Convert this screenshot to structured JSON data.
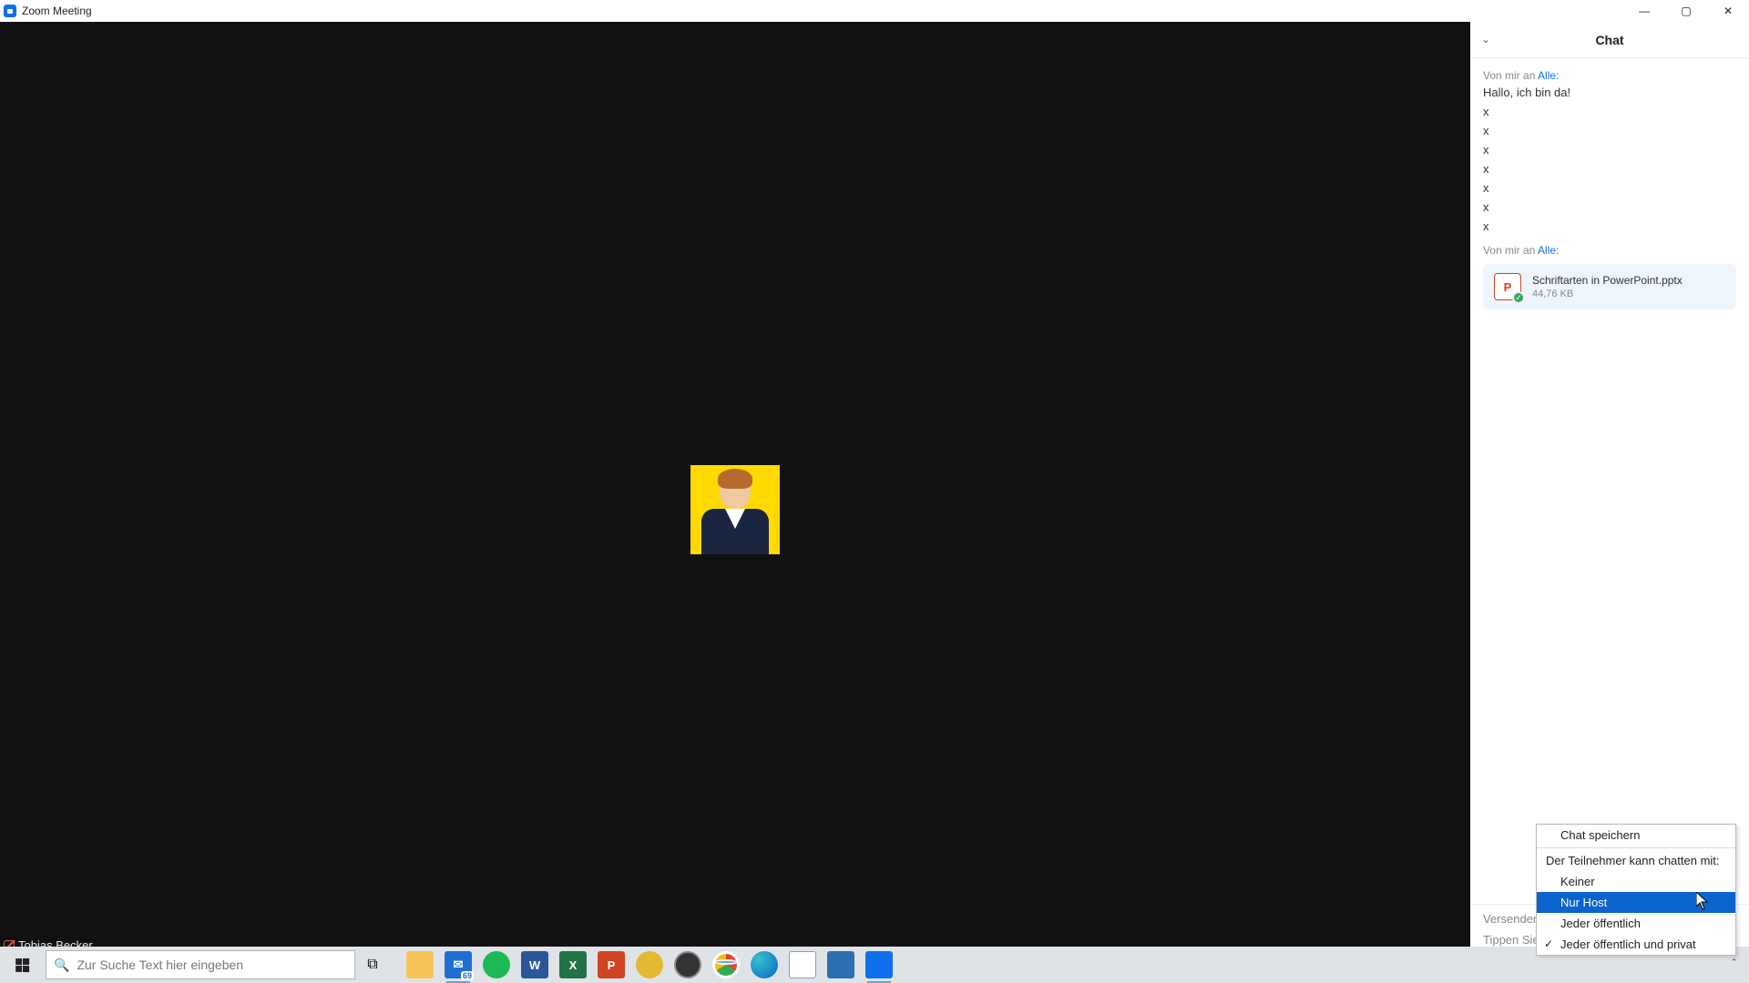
{
  "window": {
    "title": "Zoom Meeting"
  },
  "participant": {
    "name": "Tobias Becker"
  },
  "chat": {
    "title": "Chat",
    "messages": [
      {
        "header_prefix": "Von mir an ",
        "header_target": "Alle:",
        "lines": [
          "Hallo, ich bin da!",
          "x",
          "x",
          "x",
          "x",
          "x",
          "x",
          "x"
        ]
      }
    ],
    "file_message": {
      "header_prefix": "Von mir an ",
      "header_target": "Alle:",
      "file_name": "Schriftarten in PowerPoint.pptx",
      "file_size": "44,76 KB",
      "icon_letter": "P"
    },
    "send_to_label": "Versenden a",
    "input_placeholder": "Tippen Sie"
  },
  "context_menu": {
    "save": "Chat speichern",
    "section_label": "Der Teilnehmer kann chatten mit:",
    "options": {
      "none": "Keiner",
      "host_only": "Nur Host",
      "public": "Jeder öffentlich",
      "public_private": "Jeder öffentlich und privat"
    }
  },
  "taskbar": {
    "search_placeholder": "Zur Suche Text hier eingeben",
    "mail_badge": "69"
  }
}
